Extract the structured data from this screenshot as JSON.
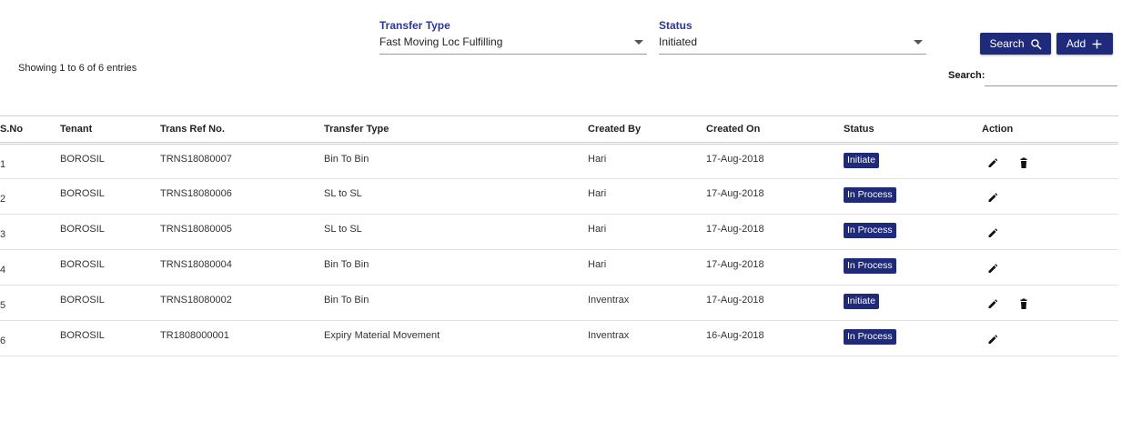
{
  "filters": {
    "transfer_type": {
      "label": "Transfer Type",
      "value": "Fast Moving Loc Fulfilling"
    },
    "status": {
      "label": "Status",
      "value": "Initiated"
    }
  },
  "buttons": {
    "search_label": "Search",
    "add_label": "Add"
  },
  "showing_text": "Showing 1 to 6 of 6 entries",
  "search": {
    "label": "Search:",
    "value": ""
  },
  "table": {
    "columns": [
      "S.No",
      "Tenant",
      "Trans Ref No.",
      "Transfer Type",
      "Created By",
      "Created On",
      "Status",
      "Action"
    ],
    "rows": [
      {
        "sno": "1",
        "tenant": "BOROSIL",
        "ref": "TRNS18080007",
        "type": "Bin To Bin",
        "created_by": "Hari",
        "created_on": "17-Aug-2018",
        "status": "Initiate",
        "actions": [
          "edit",
          "delete"
        ]
      },
      {
        "sno": "2",
        "tenant": "BOROSIL",
        "ref": "TRNS18080006",
        "type": "SL to SL",
        "created_by": "Hari",
        "created_on": "17-Aug-2018",
        "status": "In Process",
        "actions": [
          "edit"
        ]
      },
      {
        "sno": "3",
        "tenant": "BOROSIL",
        "ref": "TRNS18080005",
        "type": "SL to SL",
        "created_by": "Hari",
        "created_on": "17-Aug-2018",
        "status": "In Process",
        "actions": [
          "edit"
        ]
      },
      {
        "sno": "4",
        "tenant": "BOROSIL",
        "ref": "TRNS18080004",
        "type": "Bin To Bin",
        "created_by": "Hari",
        "created_on": "17-Aug-2018",
        "status": "In Process",
        "actions": [
          "edit"
        ]
      },
      {
        "sno": "5",
        "tenant": "BOROSIL",
        "ref": "TRNS18080002",
        "type": "Bin To Bin",
        "created_by": "Inventrax",
        "created_on": "17-Aug-2018",
        "status": "Initiate",
        "actions": [
          "edit",
          "delete"
        ]
      },
      {
        "sno": "6",
        "tenant": "BOROSIL",
        "ref": "TR1808000001",
        "type": "Expiry Material Movement",
        "created_by": "Inventrax",
        "created_on": "16-Aug-2018",
        "status": "In Process",
        "actions": [
          "edit"
        ]
      }
    ]
  },
  "icons": {
    "search": "search-icon",
    "add": "plus-icon",
    "edit": "pencil-icon",
    "delete": "trash-icon",
    "dropdown": "caret-down-icon"
  },
  "colors": {
    "accent": "#1f2a7a",
    "label": "#2b3990"
  }
}
